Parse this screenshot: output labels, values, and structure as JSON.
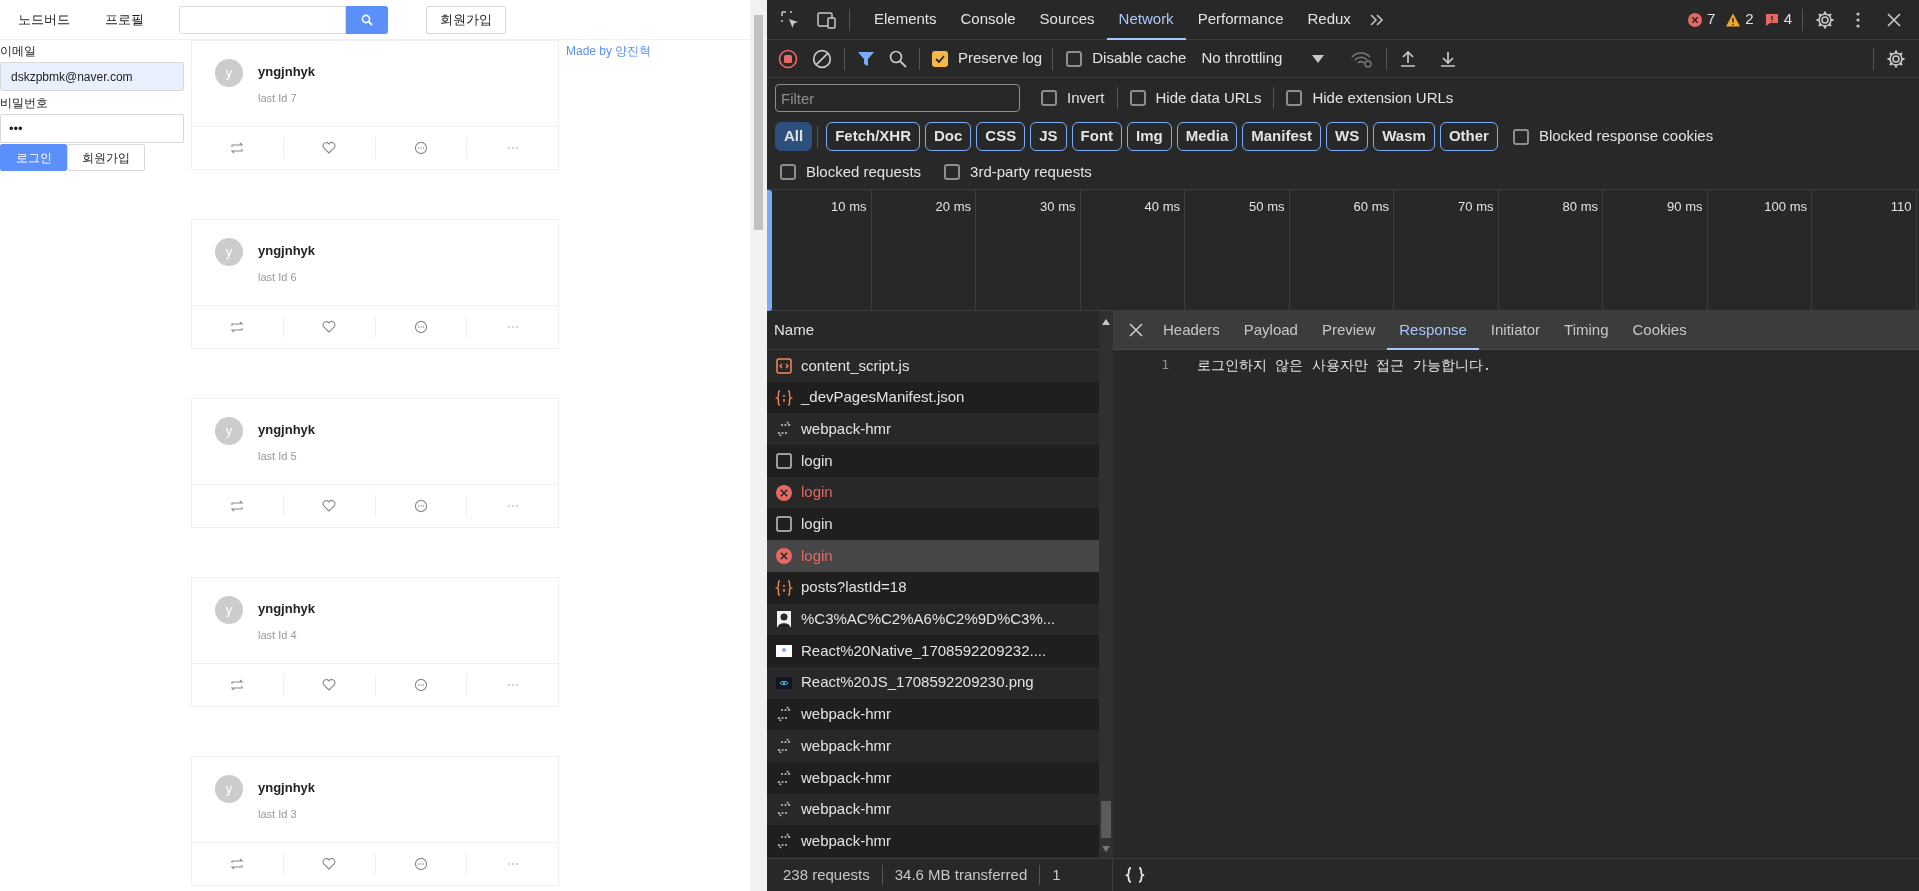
{
  "page": {
    "nav": {
      "items": [
        "노드버드",
        "프로필"
      ],
      "signup_button": "회원가입"
    },
    "login_form": {
      "email_label": "이메일",
      "email_value": "dskzpbmk@naver.com",
      "password_label": "비밀번호",
      "password_value": "•••",
      "buttons": [
        {
          "label": "로그인",
          "kind": "primary"
        },
        {
          "label": "회원가입",
          "kind": "default"
        }
      ]
    },
    "posts": [
      {
        "avatar": "y",
        "author": "yngjnhyk",
        "content": "last Id 7"
      },
      {
        "avatar": "y",
        "author": "yngjnhyk",
        "content": "last Id 6"
      },
      {
        "avatar": "y",
        "author": "yngjnhyk",
        "content": "last Id 5"
      },
      {
        "avatar": "y",
        "author": "yngjnhyk",
        "content": "last Id 4"
      },
      {
        "avatar": "y",
        "author": "yngjnhyk",
        "content": "last Id 3"
      }
    ],
    "credit": "Made by 양진혁"
  },
  "devtools": {
    "tabs": [
      {
        "label": "Elements",
        "selected": false
      },
      {
        "label": "Console",
        "selected": false
      },
      {
        "label": "Sources",
        "selected": false
      },
      {
        "label": "Network",
        "selected": true
      },
      {
        "label": "Performance",
        "selected": false
      },
      {
        "label": "Redux",
        "selected": false
      }
    ],
    "counts": {
      "errors": "7",
      "warnings": "2",
      "issues": "4"
    },
    "toolbar": {
      "recording": true,
      "preserve_log": {
        "label": "Preserve log",
        "checked": true
      },
      "disable_cache": {
        "label": "Disable cache",
        "checked": false
      },
      "throttling": "No throttling"
    },
    "filter": {
      "placeholder": "Filter"
    },
    "filter_checks": [
      {
        "label": "Invert",
        "checked": false
      },
      {
        "label": "Hide data URLs",
        "checked": false
      },
      {
        "label": "Hide extension URLs",
        "checked": false
      }
    ],
    "type_filters": [
      {
        "label": "All",
        "selected": true
      },
      {
        "label": "Fetch/XHR",
        "selected": false
      },
      {
        "label": "Doc",
        "selected": false
      },
      {
        "label": "CSS",
        "selected": false
      },
      {
        "label": "JS",
        "selected": false
      },
      {
        "label": "Font",
        "selected": false
      },
      {
        "label": "Img",
        "selected": false
      },
      {
        "label": "Media",
        "selected": false
      },
      {
        "label": "Manifest",
        "selected": false
      },
      {
        "label": "WS",
        "selected": false
      },
      {
        "label": "Wasm",
        "selected": false
      },
      {
        "label": "Other",
        "selected": false
      }
    ],
    "more_checks": [
      {
        "label": "Blocked response cookies",
        "checked": false
      },
      {
        "label": "Blocked requests",
        "checked": false
      },
      {
        "label": "3rd-party requests",
        "checked": false
      }
    ],
    "timeline_ticks": [
      "10 ms",
      "20 ms",
      "30 ms",
      "40 ms",
      "50 ms",
      "60 ms",
      "70 ms",
      "80 ms",
      "90 ms",
      "100 ms",
      "110"
    ],
    "requests": {
      "column": "Name",
      "rows": [
        {
          "name": "content_script.js",
          "kind": "script",
          "selected": false
        },
        {
          "name": "_devPagesManifest.json",
          "kind": "json",
          "selected": false
        },
        {
          "name": "webpack-hmr",
          "kind": "socket",
          "selected": false
        },
        {
          "name": "login",
          "kind": "other",
          "selected": false
        },
        {
          "name": "login",
          "kind": "failed",
          "selected": false
        },
        {
          "name": "login",
          "kind": "other",
          "selected": false
        },
        {
          "name": "login",
          "kind": "failed",
          "selected": true
        },
        {
          "name": "posts?lastId=18",
          "kind": "json",
          "selected": false
        },
        {
          "name": "%C3%AC%C2%A6%C2%9D%C3%...",
          "kind": "image",
          "selected": false
        },
        {
          "name": "React%20Native_1708592209232....",
          "kind": "image",
          "selected": false
        },
        {
          "name": "React%20JS_1708592209230.png",
          "kind": "image",
          "selected": false
        },
        {
          "name": "webpack-hmr",
          "kind": "socket",
          "selected": false
        },
        {
          "name": "webpack-hmr",
          "kind": "socket",
          "selected": false
        },
        {
          "name": "webpack-hmr",
          "kind": "socket",
          "selected": false
        },
        {
          "name": "webpack-hmr",
          "kind": "socket",
          "selected": false
        },
        {
          "name": "webpack-hmr",
          "kind": "socket",
          "selected": false
        }
      ]
    },
    "detail": {
      "tabs": [
        {
          "label": "Headers",
          "selected": false
        },
        {
          "label": "Payload",
          "selected": false
        },
        {
          "label": "Preview",
          "selected": false
        },
        {
          "label": "Response",
          "selected": true
        },
        {
          "label": "Initiator",
          "selected": false
        },
        {
          "label": "Timing",
          "selected": false
        },
        {
          "label": "Cookies",
          "selected": false
        }
      ],
      "lines": [
        {
          "number": "1",
          "text": "로그인하지 않은 사용자만 접근 가능합니다."
        }
      ]
    },
    "status_bar": [
      "238 requests",
      "34.6 MB transferred",
      "1"
    ]
  }
}
